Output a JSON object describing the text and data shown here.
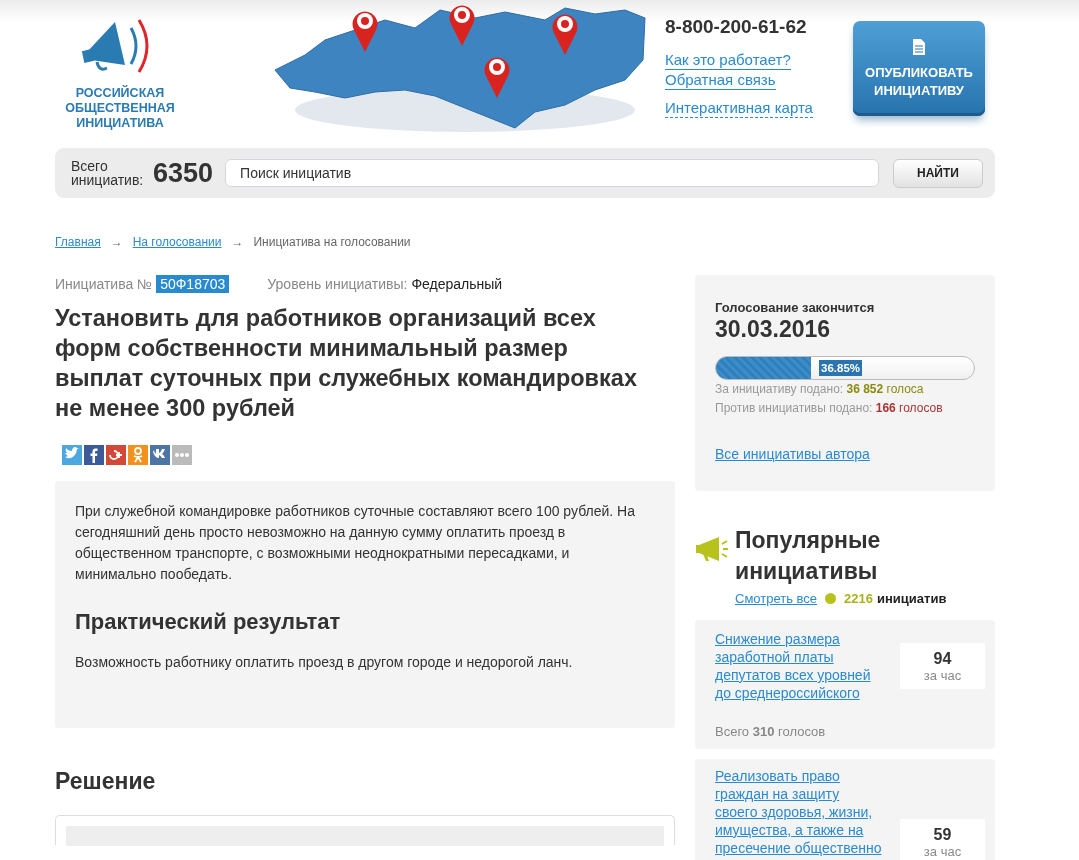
{
  "header": {
    "logo_lines": [
      "РОССИЙСКАЯ",
      "ОБЩЕСТВЕННАЯ",
      "ИНИЦИАТИВА"
    ],
    "phone": "8-800-200-61-62",
    "links": [
      {
        "label": "Как это работает?",
        "kind": "solid"
      },
      {
        "label": "Обратная связь",
        "kind": "solid"
      },
      {
        "label": "Интерактивная карта",
        "kind": "dashed"
      }
    ],
    "publish_button": "ОПУБЛИКОВАТЬ ИНИЦИАТИВУ"
  },
  "search": {
    "total_label": "Всего инициатив:",
    "total": "6350",
    "placeholder": "Поиск инициатив",
    "button": "НАЙТИ"
  },
  "breadcrumbs": {
    "separator": "→",
    "items": [
      {
        "label": "Главная",
        "kind": "link"
      },
      {
        "label": "На голосовании",
        "kind": "link"
      },
      {
        "label": "Инициатива на голосовании",
        "kind": "current"
      }
    ]
  },
  "initiative": {
    "number_label": "Инициатива №",
    "number": "50Ф18703",
    "level_label": "Уровень инициативы:",
    "level": "Федеральный",
    "title": "Установить для работников организаций всех форм собственности минимальный размер выплат суточных при служебных командировках не менее 300 рублей",
    "share_buttons": [
      {
        "kind": "twitter"
      },
      {
        "kind": "facebook"
      },
      {
        "kind": "gplus"
      },
      {
        "kind": "ok"
      },
      {
        "kind": "vk"
      },
      {
        "kind": "more"
      }
    ],
    "description": "При служебной командировке работников суточные составляют всего 100 рублей. На сегодняшний день просто невозможно на данную сумму оплатить проезд в общественном транспорте, с возможными неоднократными пересадками, и минимально пообедать.",
    "result_heading": "Практический результат",
    "result_text": "Возможность работнику оплатить проезд в другом городе и недорогой ланч.",
    "decision_heading": "Решение"
  },
  "voting": {
    "ends_label": "Голосование закончится",
    "end_date": "30.03.2016",
    "level": 0.3685,
    "percent": "36.85%",
    "for_label": "За инициативу подано:",
    "for_value": "**36 852** голоса",
    "against_label": "Против инициативы подано:",
    "against_value": "**166** голосов",
    "author_link": "Все инициативы автора"
  },
  "popular": {
    "title": "Популярные инициативы",
    "see_all": "Смотреть все",
    "count": "2216",
    "count_label": "инициатив",
    "items": [
      {
        "title": "Снижение размера заработной платы депутатов всех уровней до среднероссийского",
        "per_hour": "94",
        "per_hour_label": "за час",
        "total": "Всего **310** голосов"
      },
      {
        "title": "Реализовать право граждан на защиту своего здоровья, жизни, имущества, а также на пресечение общественно",
        "per_hour": "59",
        "per_hour_label": "за час"
      }
    ]
  }
}
